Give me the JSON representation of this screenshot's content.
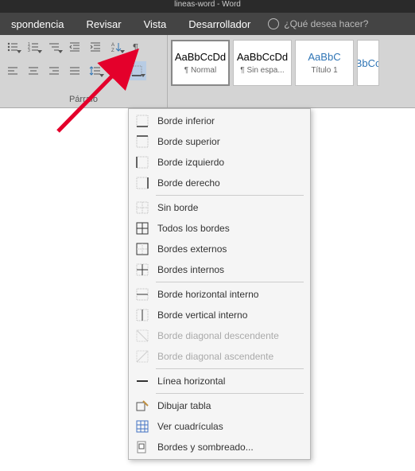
{
  "titlebar": {
    "text": "lineas-word - Word"
  },
  "tabs": {
    "correspondencia": "spondencia",
    "revisar": "Revisar",
    "vista": "Vista",
    "desarrollador": "Desarrollador",
    "tell_me": "¿Qué desea hacer?"
  },
  "paragraph": {
    "label": "Párrafo"
  },
  "styles": {
    "normal": {
      "sample": "AaBbCcDd",
      "name": "¶ Normal"
    },
    "sin_espaciado": {
      "sample": "AaBbCcDd",
      "name": "¶ Sin espa..."
    },
    "titulo1": {
      "sample": "AaBbC",
      "name": "Título 1"
    },
    "titulo2": {
      "sample": "AaBbCcDd",
      "name": ""
    }
  },
  "menu": {
    "borde_inferior": "Borde inferior",
    "borde_superior": "Borde superior",
    "borde_izquierdo": "Borde izquierdo",
    "borde_derecho": "Borde derecho",
    "sin_borde": "Sin borde",
    "todos_bordes": "Todos los bordes",
    "bordes_externos": "Bordes externos",
    "bordes_internos": "Bordes internos",
    "borde_horizontal_interno": "Borde horizontal interno",
    "borde_vertical_interno": "Borde vertical interno",
    "borde_diagonal_desc": "Borde diagonal descendente",
    "borde_diagonal_asc": "Borde diagonal ascendente",
    "linea_horizontal": "Línea horizontal",
    "dibujar_tabla": "Dibujar tabla",
    "ver_cuadriculas": "Ver cuadrículas",
    "bordes_sombreado": "Bordes y sombreado..."
  }
}
